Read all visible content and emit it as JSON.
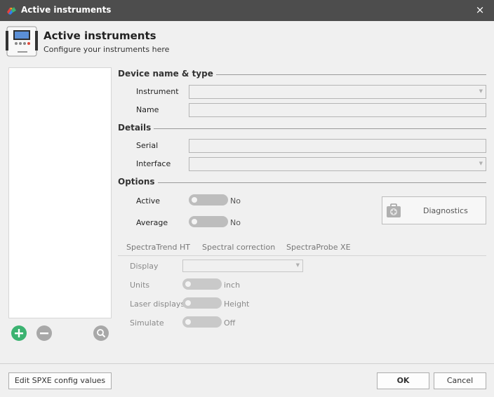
{
  "window": {
    "title": "Active instruments",
    "close_icon": "×"
  },
  "header": {
    "title": "Active instruments",
    "subtitle": "Configure your instruments here"
  },
  "sections": {
    "device": "Device name & type",
    "details": "Details",
    "options": "Options"
  },
  "fields": {
    "instrument": {
      "label": "Instrument",
      "value": ""
    },
    "name": {
      "label": "Name",
      "value": ""
    },
    "serial": {
      "label": "Serial",
      "value": ""
    },
    "interface": {
      "label": "Interface",
      "value": ""
    }
  },
  "options": {
    "active": {
      "label": "Active",
      "state": "No"
    },
    "average": {
      "label": "Average",
      "state": "No"
    }
  },
  "diagnostics": {
    "label": "Diagnostics",
    "icon": "first-aid-kit-icon"
  },
  "tabs": [
    "SpectraTrend HT",
    "Spectral correction",
    "SpectraProbe XE"
  ],
  "tab_fields": {
    "display": {
      "label": "Display",
      "value": ""
    },
    "units": {
      "label": "Units",
      "state": "inch"
    },
    "laser_displays": {
      "label": "Laser displays",
      "state": "Height"
    },
    "simulate": {
      "label": "Simulate",
      "state": "Off"
    }
  },
  "list_actions": {
    "add_icon": "plus-circle-icon",
    "remove_icon": "minus-circle-icon",
    "search_icon": "search-icon"
  },
  "footer": {
    "edit_config": "Edit SPXE config values",
    "ok": "OK",
    "cancel": "Cancel"
  },
  "colors": {
    "titlebar": "#4d4d4d",
    "add_green": "#3cb371",
    "disabled_gray": "#a8a8a8"
  }
}
